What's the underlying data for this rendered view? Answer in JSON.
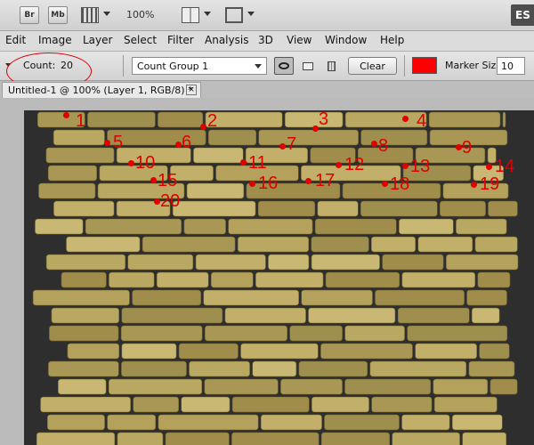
{
  "appbar": {
    "br_label": "Br",
    "mb_label": "Mb",
    "zoom": "100%",
    "workspace": "ES"
  },
  "menu": [
    "Edit",
    "Image",
    "Layer",
    "Select",
    "Filter",
    "Analysis",
    "3D",
    "View",
    "Window",
    "Help"
  ],
  "options": {
    "count_label": "Count:",
    "count_value": "20",
    "group": "Count Group 1",
    "clear_label": "Clear",
    "marker_color": "#ff0000",
    "marker_size_label": "Marker Size:",
    "marker_size": "10"
  },
  "document": {
    "title": "Untitled-1 @ 100% (Layer 1, RGB/8) *",
    "close": "×"
  },
  "accent": "#e00000",
  "brick_color": "#b8a660",
  "count_marks": [
    "1",
    "2",
    "3",
    "4",
    "5",
    "6",
    "7",
    "8",
    "9",
    "10",
    "11",
    "12",
    "13",
    "14",
    "15",
    "16",
    "17",
    "18",
    "19",
    "20"
  ]
}
